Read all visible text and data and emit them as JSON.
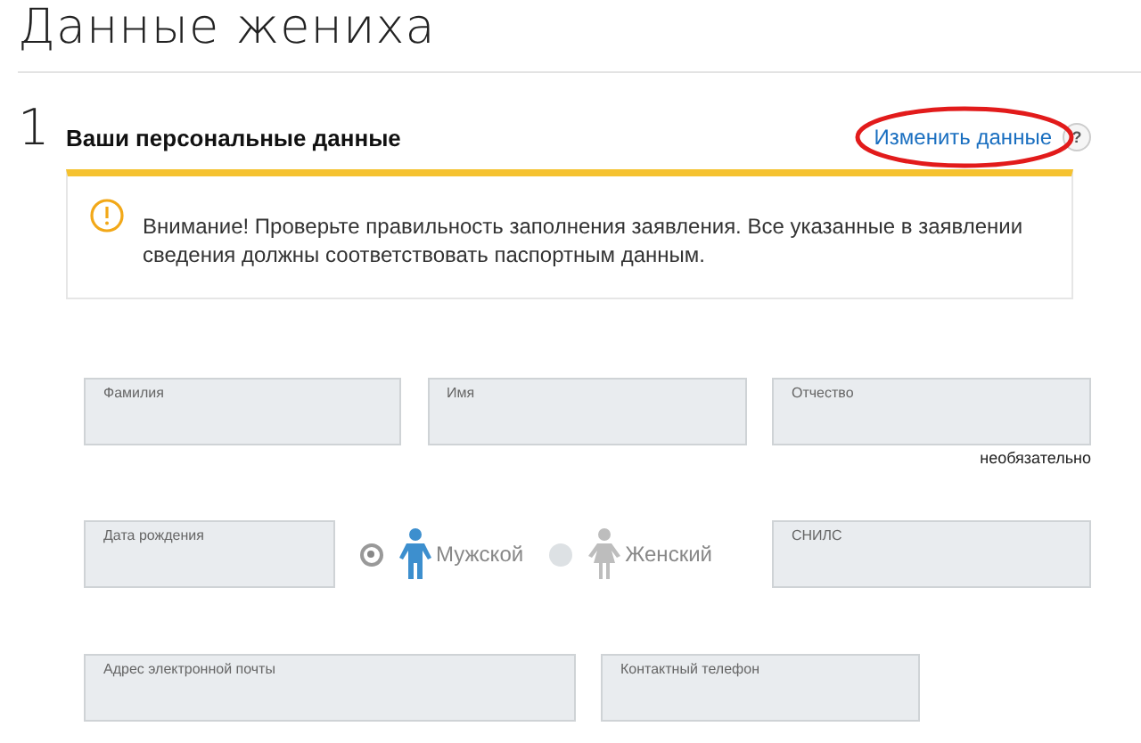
{
  "page_title": "Данные жениха",
  "section": {
    "number": "1",
    "title": "Ваши персональные данные",
    "edit_link": "Изменить данные",
    "help": "?",
    "highlighted": true
  },
  "alert": {
    "text": "Внимание! Проверьте правильность заполнения заявления. Все указанные в заявлении сведения должны соответствовать паспортным данным."
  },
  "name_fields": [
    {
      "placeholder": "Фамилия"
    },
    {
      "placeholder": "Имя"
    },
    {
      "placeholder": "Отчество",
      "note": "необязательно"
    }
  ],
  "birth_date": {
    "placeholder": "Дата рождения"
  },
  "gender": [
    {
      "label": "Мужской",
      "kind": "male",
      "selected": true
    },
    {
      "label": "Женский",
      "kind": "female",
      "selected": false
    }
  ],
  "snils": {
    "placeholder": "СНИЛС"
  },
  "email": {
    "placeholder": "Адрес электронной почты"
  },
  "phone": {
    "placeholder": "Контактный телефон"
  }
}
